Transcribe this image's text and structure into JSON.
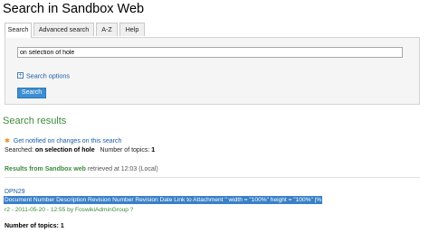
{
  "page": {
    "title": "Search in Sandbox Web"
  },
  "tabs": [
    {
      "label": "Search",
      "active": true
    },
    {
      "label": "Advanced search",
      "active": false
    },
    {
      "label": "A-Z",
      "active": false
    },
    {
      "label": "Help",
      "active": false
    }
  ],
  "search": {
    "query": "on selection of hole",
    "options_label": "Search options",
    "button_label": "Search"
  },
  "results": {
    "title": "Search results",
    "notify_link": "Get notified on changes on this search",
    "searched_label": "Searched:",
    "searched_query": "on selection of hole",
    "num_topics_label": "Number of topics:",
    "num_topics_value": "1",
    "results_from_label": "Results from",
    "web_name": "Sandbox web",
    "retrieved_text": "retrieved at 12:03 (Local)",
    "items": [
      {
        "topic": "DPN29",
        "summary": "Document Number Description Revision Number Revision Date Link to Attachment \" width = \"100%\" height = \"100%\" |%",
        "revision": "r2 - 2011-05-20 - 12:55 by",
        "author": "FoswikiAdminGroup ?"
      }
    ],
    "footer_count_label": "Number of topics:",
    "footer_count_value": "1"
  },
  "colors": {
    "link_blue": "#1a5ea8",
    "heading_green": "#3c8a3c",
    "button_blue": "#3d8ed3",
    "highlight_blue": "#3a80c8",
    "rss_orange": "#f08a1c"
  },
  "icons": {
    "options": "plus-box-icon",
    "notify": "rss-icon"
  }
}
